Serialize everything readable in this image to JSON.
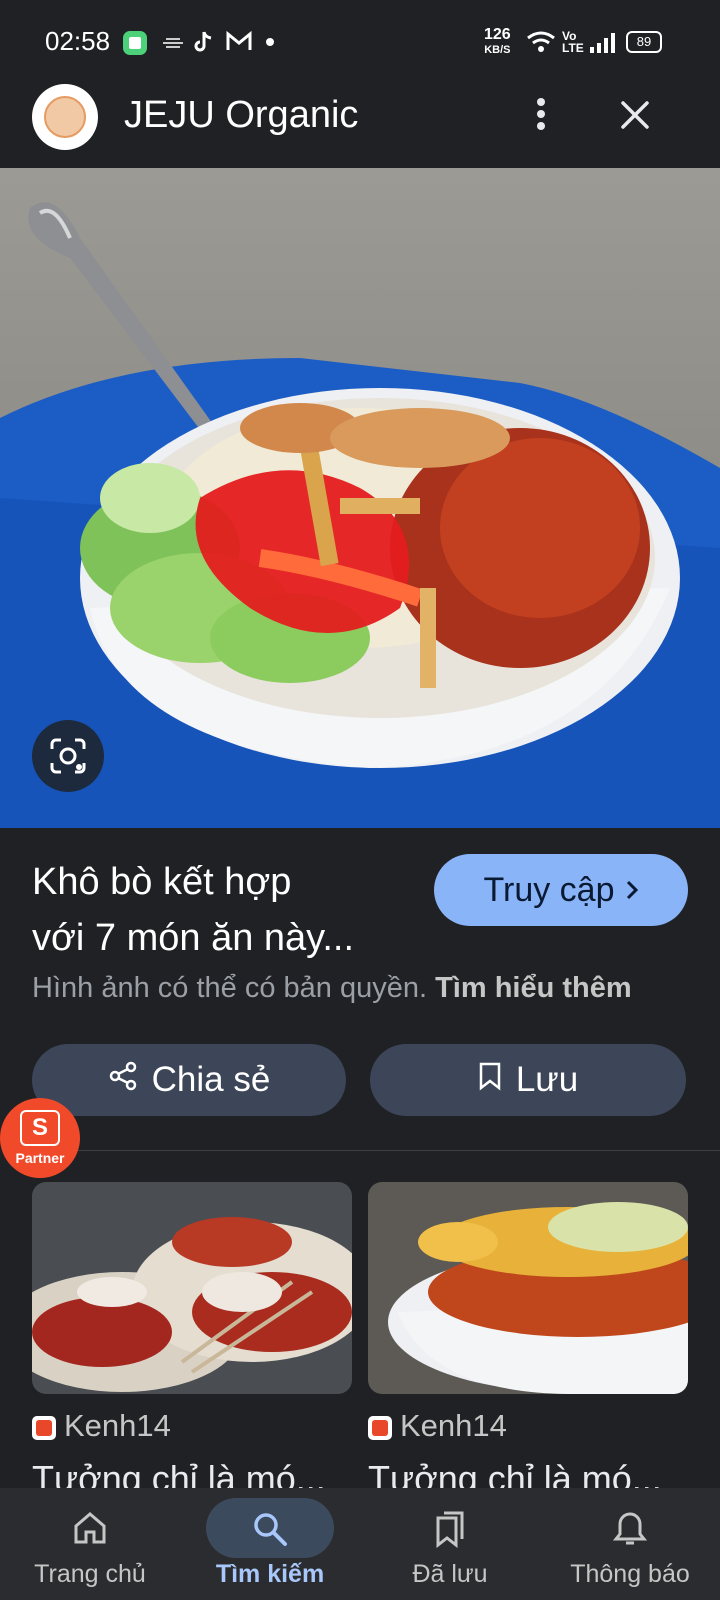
{
  "status_bar": {
    "time": "02:58",
    "net_speed_value": "126",
    "net_speed_unit": "KB/S",
    "volte_top": "Vo",
    "volte_bottom": "LTE",
    "battery": "89",
    "icons": [
      "app-icon",
      "weather-icon",
      "tiktok-icon",
      "gmail-icon",
      "dot-icon",
      "wifi-icon",
      "signal-icon",
      "battery-icon"
    ]
  },
  "header": {
    "title": "JEJU Organic",
    "menu_icon": "more-vert-icon",
    "close_icon": "close-icon"
  },
  "result": {
    "headline_line1": "Khô bò kết hợp",
    "headline_line2": "với 7 món ăn này...",
    "visit_label": "Truy cập",
    "copyright_text": "Hình ảnh có thể có bản quyền.",
    "learn_more": "Tìm hiểu thêm",
    "share_label": "Chia sẻ",
    "save_label": "Lưu"
  },
  "partner": {
    "label": "Partner",
    "letter": "S"
  },
  "related": [
    {
      "source": "Kenh14",
      "title": "Tưởng chỉ là mó..."
    },
    {
      "source": "Kenh14",
      "title": "Tưởng chỉ là mó..."
    }
  ],
  "nav": [
    {
      "label": "Trang chủ",
      "icon": "home-icon"
    },
    {
      "label": "Tìm kiếm",
      "icon": "search-icon",
      "active": true
    },
    {
      "label": "Đã lưu",
      "icon": "bookmarks-icon"
    },
    {
      "label": "Thông báo",
      "icon": "bell-icon"
    }
  ],
  "colors": {
    "background": "#202124",
    "accent": "#8ab4f8",
    "button": "#3c4658"
  }
}
